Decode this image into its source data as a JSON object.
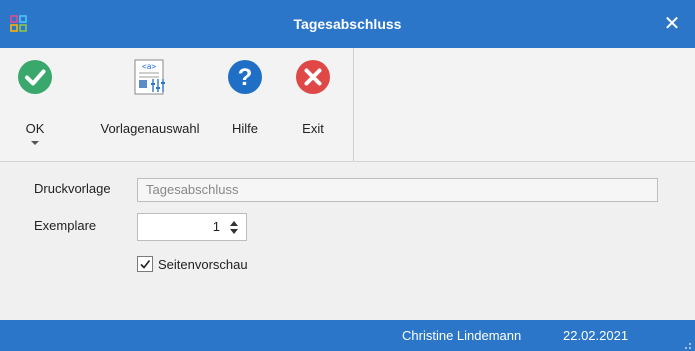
{
  "window": {
    "title": "Tagesabschluss"
  },
  "ribbon": {
    "buttons": [
      {
        "label": "OK"
      },
      {
        "label": "Vorlagenauswahl"
      },
      {
        "label": "Hilfe"
      },
      {
        "label": "Exit"
      }
    ]
  },
  "form": {
    "druckvorlage": {
      "label": "Druckvorlage",
      "value": "Tagesabschluss"
    },
    "exemplare": {
      "label": "Exemplare",
      "value": "1"
    },
    "seitenvorschau": {
      "label": "Seitenvorschau",
      "checked": true
    }
  },
  "statusbar": {
    "user": "Christine Lindemann",
    "date": "22.02.2021"
  },
  "colors": {
    "titlebar": "#2b76c9",
    "ok": "#3aa76d",
    "help": "#1f6fc6",
    "exit": "#e04848"
  }
}
